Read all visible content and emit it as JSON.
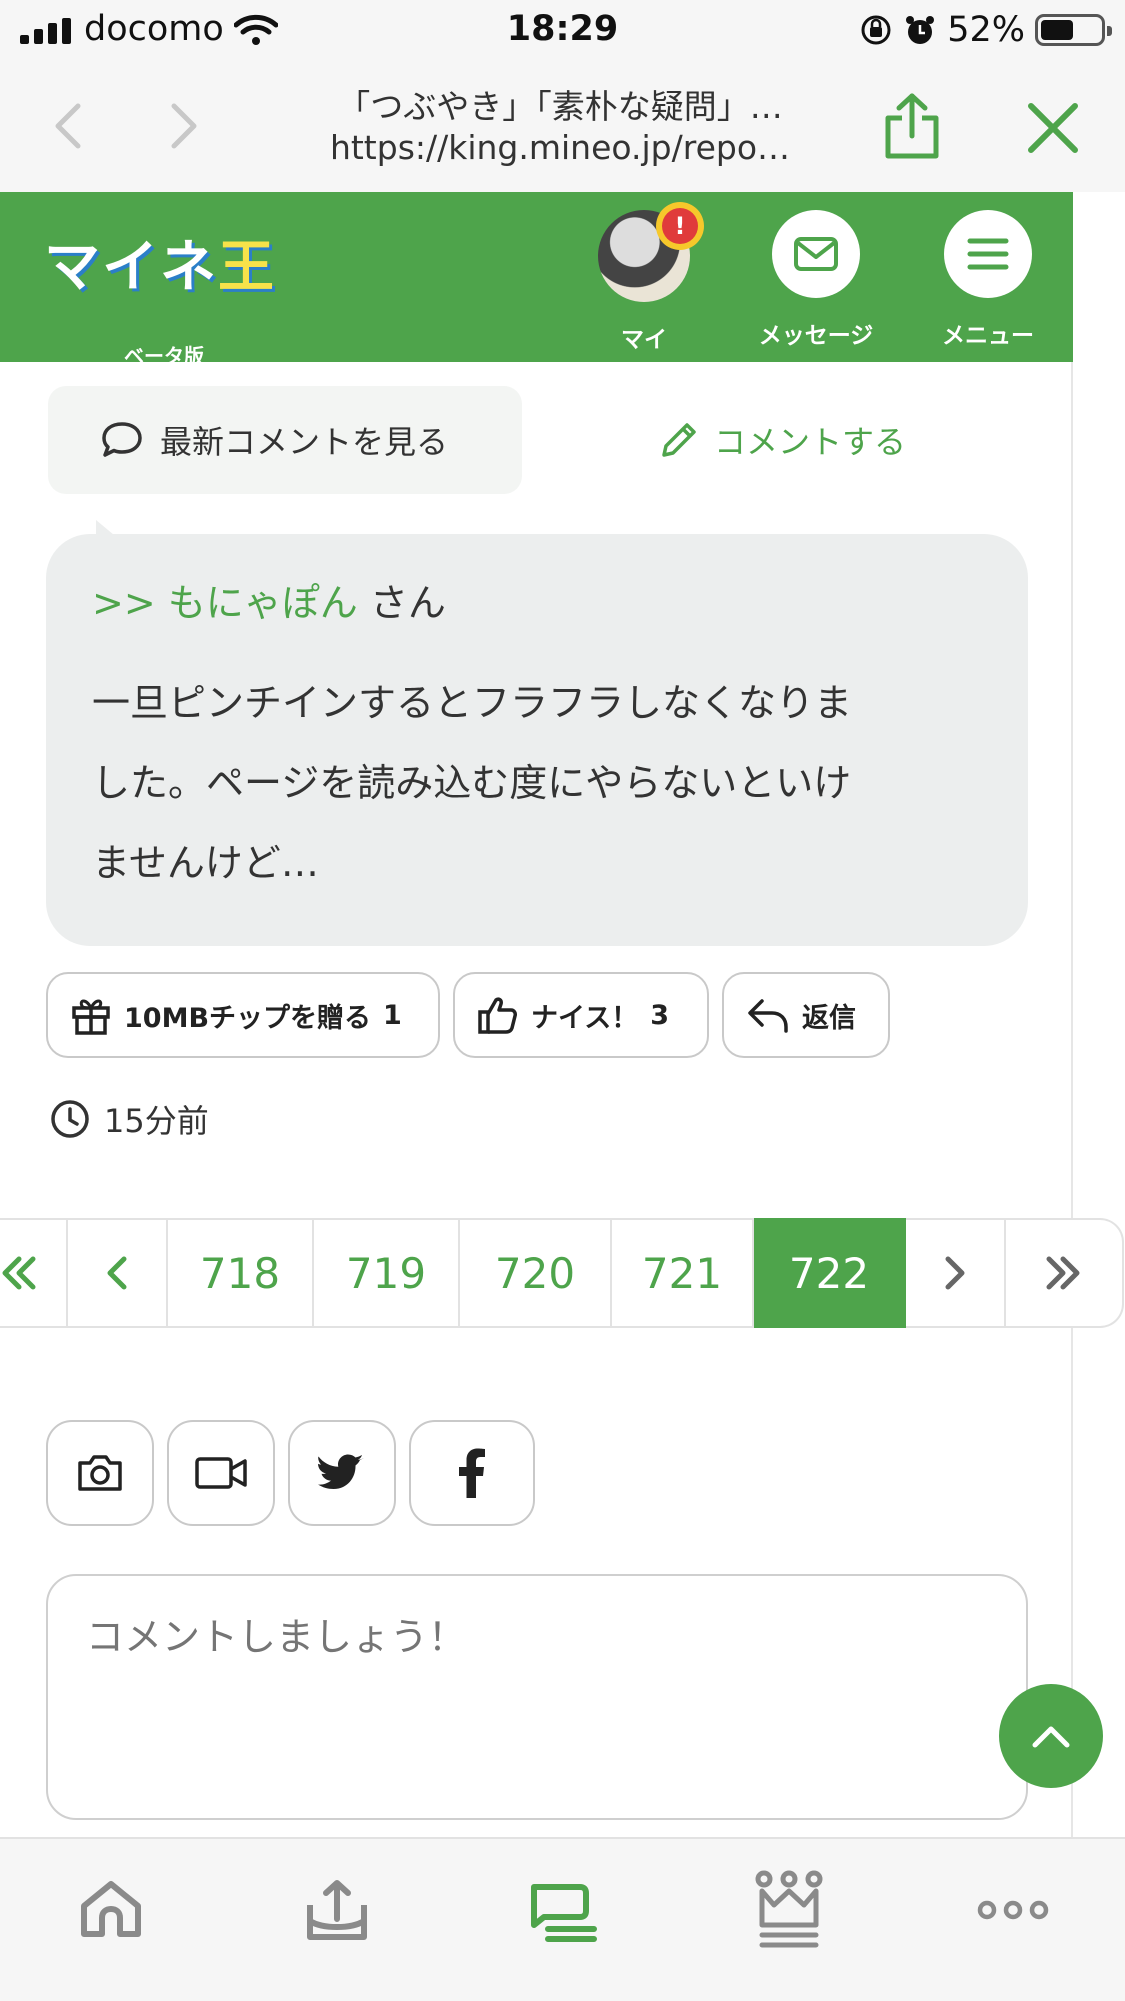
{
  "status_bar": {
    "carrier": "docomo",
    "time": "18:29",
    "battery": "52%"
  },
  "browser": {
    "page_title": "「つぶやき」「素朴な疑問」…",
    "url": "https://king.mineo.jp/repo…"
  },
  "header": {
    "logo_text_a": "マイネ",
    "logo_text_b": "王",
    "logo_sub": "ベータ版",
    "my_label": "マイ",
    "alert_mark": "!",
    "message_label": "メッセージ",
    "menu_label": "メニュー"
  },
  "tabs": {
    "latest": "最新コメントを見る",
    "comment": "コメントする"
  },
  "comment": {
    "reply_prefix": ">>",
    "reply_user": "もにゃぽん",
    "reply_suffix": "さん",
    "lines": [
      "一旦ピンチインするとフラフラしなくなりま",
      "した。ページを読み込む度にやらないといけ",
      "ませんけど…"
    ]
  },
  "actions": {
    "tip_label": "10MBチップを贈る",
    "tip_count": "1",
    "nice_label": "ナイス！",
    "nice_count": "3",
    "reply_label": "返信"
  },
  "timestamp": "15分前",
  "pagination": {
    "pages": [
      "718",
      "719",
      "720",
      "721",
      "722"
    ],
    "current": "722"
  },
  "compose": {
    "placeholder": "コメントしましょう！"
  },
  "colors": {
    "brand_green": "#4ea44b",
    "bubble_gray": "#eceeee"
  }
}
